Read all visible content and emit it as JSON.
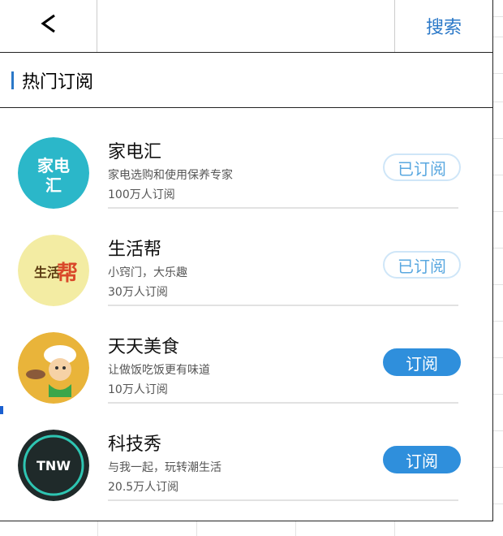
{
  "topbar": {
    "back_label": "<",
    "search_label": "搜索"
  },
  "section": {
    "title": "热门订阅"
  },
  "items": [
    {
      "title": "家电汇",
      "description": "家电选购和使用保养专家",
      "count": "100万人订阅",
      "button": "已订阅",
      "subscribed": true,
      "logo_text": "家电汇",
      "logo_color": "#2bb7c9"
    },
    {
      "title": "生活帮",
      "description": "小窍门，大乐趣",
      "count": "30万人订阅",
      "button": "已订阅",
      "subscribed": true,
      "logo_text": "生活帮",
      "logo_color": "#f3eca3"
    },
    {
      "title": "天天美食",
      "description": "让做饭吃饭更有味道",
      "count": "10万人订阅",
      "button": "订阅",
      "subscribed": false,
      "logo_color": "#e9b43a"
    },
    {
      "title": "科技秀",
      "description": "与我一起，玩转潮生活",
      "count": "20.5万人订阅",
      "button": "订阅",
      "subscribed": false,
      "logo_text": "TNW",
      "logo_color": "#1f2a2a"
    }
  ],
  "colors": {
    "accent": "#2a78c8",
    "subscribe_button": "#2f8fdc",
    "subscribed_text": "#5aa8e0"
  }
}
